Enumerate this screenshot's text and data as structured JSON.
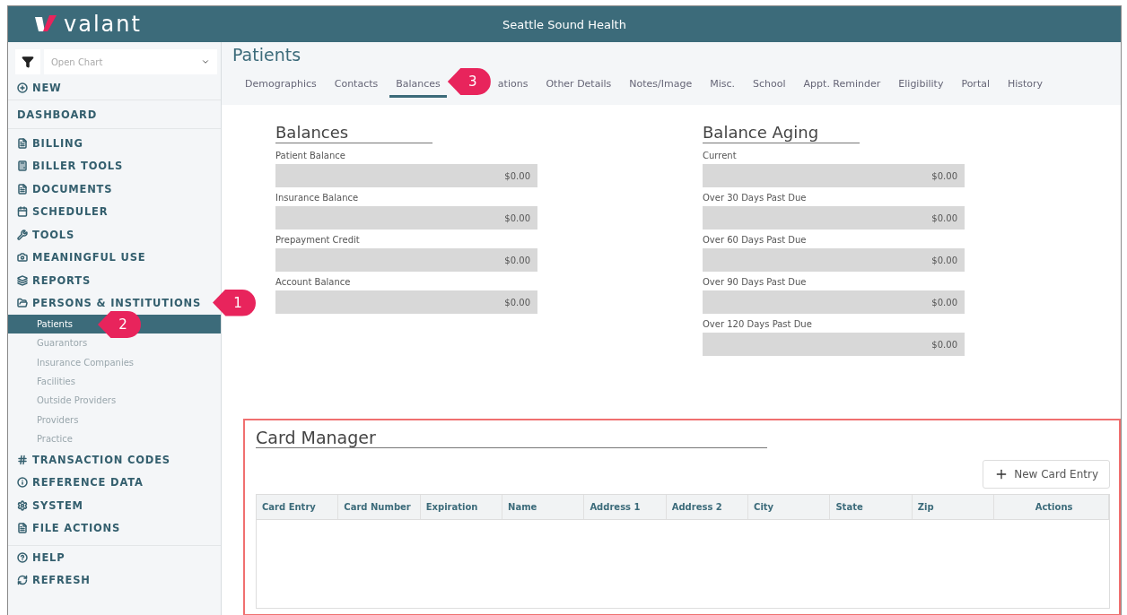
{
  "header": {
    "logo": "valant",
    "title": "Seattle Sound Health"
  },
  "sidebar": {
    "search": {
      "placeholder": "Open Chart"
    },
    "items": [
      {
        "kind": "action",
        "label": "NEW",
        "selected": false
      },
      {
        "kind": "plain",
        "label": "DASHBOARD",
        "selected": false
      },
      {
        "kind": "section",
        "label": "BILLING",
        "selected": false
      },
      {
        "kind": "section",
        "label": "BILLER TOOLS",
        "selected": false
      },
      {
        "kind": "section",
        "label": "DOCUMENTS",
        "selected": false
      },
      {
        "kind": "section",
        "label": "SCHEDULER",
        "selected": false
      },
      {
        "kind": "section",
        "label": "TOOLS",
        "selected": false
      },
      {
        "kind": "section",
        "label": "MEANINGFUL USE",
        "selected": false
      },
      {
        "kind": "section",
        "label": "REPORTS",
        "selected": false
      },
      {
        "kind": "section",
        "label": "PERSONS & INSTITUTIONS",
        "selected": false,
        "children": [
          {
            "label": "Patients",
            "selected": true
          },
          {
            "label": "Guarantors",
            "selected": false
          },
          {
            "label": "Insurance Companies",
            "selected": false
          },
          {
            "label": "Facilities",
            "selected": false
          },
          {
            "label": "Outside Providers",
            "selected": false
          },
          {
            "label": "Providers",
            "selected": false
          },
          {
            "label": "Practice",
            "selected": false
          }
        ]
      },
      {
        "kind": "section",
        "label": "TRANSACTION CODES",
        "selected": false
      },
      {
        "kind": "section",
        "label": "REFERENCE DATA",
        "selected": false
      },
      {
        "kind": "section",
        "label": "SYSTEM",
        "selected": false
      },
      {
        "kind": "section",
        "label": "FILE ACTIONS",
        "selected": false
      },
      {
        "kind": "footer",
        "label": "HELP",
        "selected": false
      },
      {
        "kind": "section",
        "label": "REFRESH",
        "selected": false
      }
    ]
  },
  "page": {
    "title": "Patients",
    "tabs": [
      {
        "label": "Demographics",
        "selected": false
      },
      {
        "label": "Contacts",
        "selected": false
      },
      {
        "label": "Balances",
        "selected": true
      },
      {
        "label": "ations",
        "selected": false
      },
      {
        "label": "Other Details",
        "selected": false
      },
      {
        "label": "Notes/Image",
        "selected": false
      },
      {
        "label": "Misc.",
        "selected": false
      },
      {
        "label": "School",
        "selected": false
      },
      {
        "label": "Appt. Reminder",
        "selected": false
      },
      {
        "label": "Eligibility",
        "selected": false
      },
      {
        "label": "Portal",
        "selected": false
      },
      {
        "label": "History",
        "selected": false
      }
    ],
    "groups": [
      {
        "title": "Balances",
        "fields": [
          {
            "label": "Patient Balance",
            "value": "$0.00"
          },
          {
            "label": "Insurance Balance",
            "value": "$0.00"
          },
          {
            "label": "Prepayment Credit",
            "value": "$0.00"
          },
          {
            "label": "Account Balance",
            "value": "$0.00"
          }
        ]
      },
      {
        "title": "Balance Aging",
        "fields": [
          {
            "label": "Current",
            "value": "$0.00"
          },
          {
            "label": "Over 30 Days Past Due",
            "value": "$0.00"
          },
          {
            "label": "Over 60 Days Past Due",
            "value": "$0.00"
          },
          {
            "label": "Over 90 Days Past Due",
            "value": "$0.00"
          },
          {
            "label": "Over 120 Days Past Due",
            "value": "$0.00"
          }
        ]
      }
    ],
    "card_manager": {
      "title": "Card Manager",
      "button": "New Card Entry",
      "columns": [
        "Card Entry",
        "Card Number",
        "Expiration",
        "Name",
        "Address 1",
        "Address 2",
        "City",
        "State",
        "Zip",
        "Actions"
      ]
    }
  },
  "callouts": [
    {
      "number": "1"
    },
    {
      "number": "2"
    },
    {
      "number": "3"
    }
  ]
}
